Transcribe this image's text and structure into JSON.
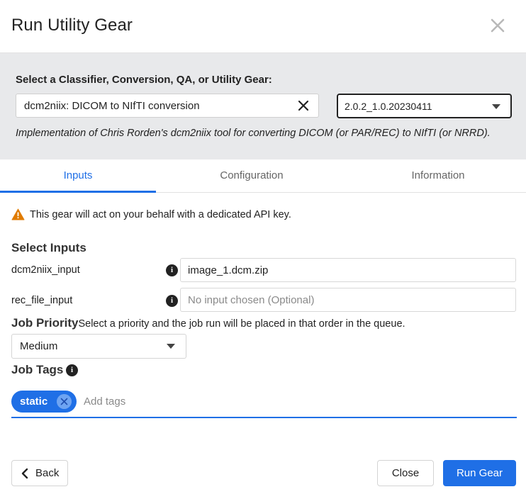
{
  "dialog": {
    "title": "Run Utility Gear"
  },
  "gear": {
    "label": "Select a Classifier, Conversion, QA, or Utility Gear:",
    "selected": "dcm2niix: DICOM to NIfTI conversion",
    "version": "2.0.2_1.0.20230411",
    "description": "Implementation of Chris Rorden's dcm2niix tool for converting DICOM (or PAR/REC) to NIfTI (or NRRD)."
  },
  "tabs": [
    {
      "label": "Inputs",
      "active": true
    },
    {
      "label": "Configuration",
      "active": false
    },
    {
      "label": "Information",
      "active": false
    }
  ],
  "warning": {
    "text": "This gear will act on your behalf with a dedicated API key."
  },
  "inputs": {
    "section_title": "Select Inputs",
    "fields": [
      {
        "label": "dcm2niix_input",
        "value": "image_1.dcm.zip",
        "placeholder": ""
      },
      {
        "label": "rec_file_input",
        "value": "",
        "placeholder": "No input chosen (Optional)"
      }
    ]
  },
  "job_priority": {
    "title": "Job Priority",
    "description": "Select a priority and the job run will be placed in that order in the queue.",
    "selected": "Medium"
  },
  "job_tags": {
    "title": "Job Tags",
    "tags": [
      "static"
    ],
    "placeholder": "Add tags"
  },
  "footer": {
    "back_label": "Back",
    "close_label": "Close",
    "run_label": "Run Gear"
  },
  "colors": {
    "accent": "#1f6fe6",
    "warning": "#e07b00",
    "panel_bg": "#e8e9eb"
  },
  "icons": {
    "close": "close-icon",
    "clear": "clear-icon",
    "caret": "caret-down-icon",
    "warning": "warning-triangle-icon",
    "info": "info-icon",
    "back": "chevron-left-icon"
  }
}
